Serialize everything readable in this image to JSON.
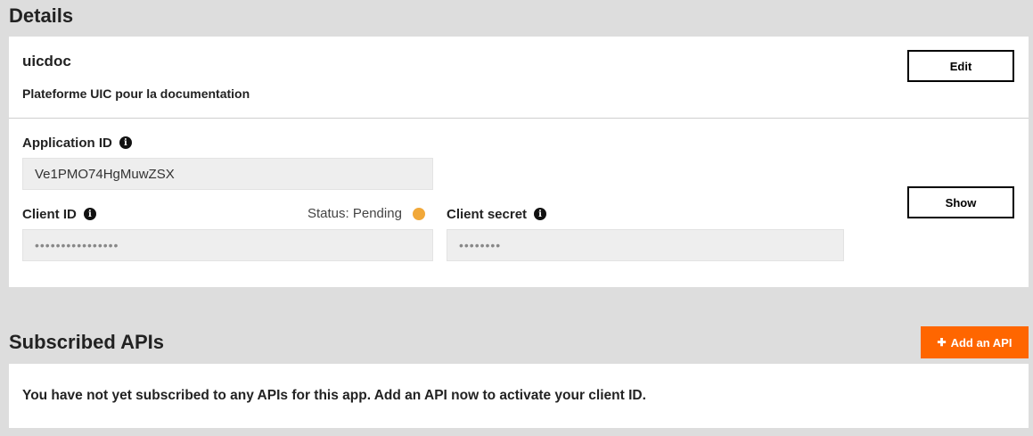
{
  "details": {
    "heading": "Details",
    "app_name": "uicdoc",
    "description": "Plateforme UIC pour la documentation",
    "edit_label": "Edit",
    "show_label": "Show",
    "application_id_label": "Application ID",
    "application_id_value": "Ve1PMO74HgMuwZSX",
    "client_id_label": "Client ID",
    "client_id_value": "••••••••••••••••",
    "status_text": "Status: Pending",
    "status_color": "#f1a839",
    "client_secret_label": "Client secret",
    "client_secret_value": "••••••••",
    "info_icon_glyph": "i"
  },
  "subscribed": {
    "heading": "Subscribed APIs",
    "add_label": "Add an API",
    "add_icon_glyph": "✚",
    "empty_message": "You have not yet subscribed to any APIs for this app. Add an API now to activate your client ID."
  },
  "colors": {
    "accent": "#ff6600",
    "background": "#dddddd",
    "card": "#ffffff"
  }
}
